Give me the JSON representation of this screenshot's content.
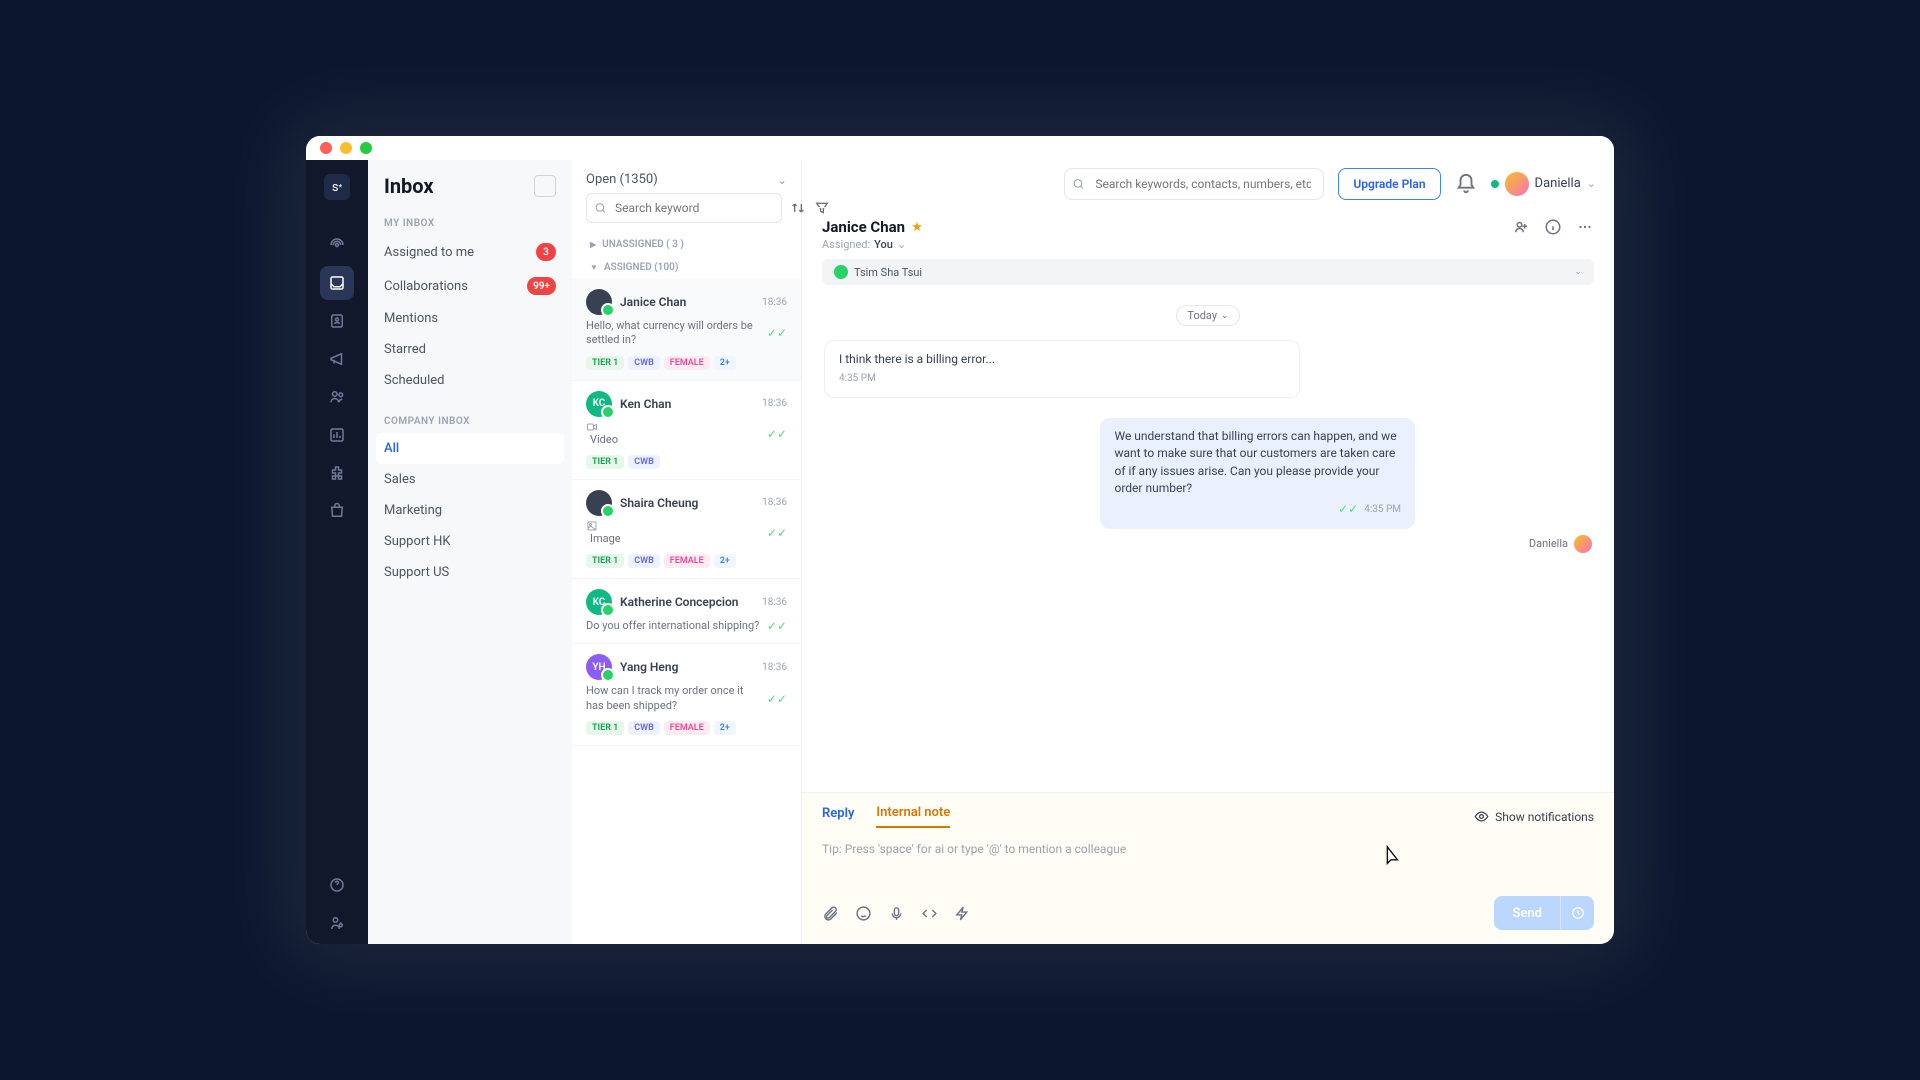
{
  "sidebar": {
    "title": "Inbox",
    "sections": {
      "myInboxLabel": "MY INBOX",
      "companyLabel": "COMPANY INBOX"
    },
    "myInbox": [
      {
        "label": "Assigned to me",
        "badge": "3"
      },
      {
        "label": "Collaborations",
        "badge": "99+"
      },
      {
        "label": "Mentions"
      },
      {
        "label": "Starred"
      },
      {
        "label": "Scheduled"
      }
    ],
    "company": [
      {
        "label": "All",
        "selected": true
      },
      {
        "label": "Sales"
      },
      {
        "label": "Marketing"
      },
      {
        "label": "Support HK"
      },
      {
        "label": "Support US"
      }
    ]
  },
  "convoList": {
    "filterLabel": "Open (1350)",
    "searchPlaceholder": "Search keyword",
    "groups": {
      "unassigned": "UNASSIGNED ( 3 )",
      "assigned": "ASSIGNED (100)"
    },
    "items": [
      {
        "name": "Janice Chan",
        "time": "18:36",
        "avatar": {
          "text": "",
          "color": "dark"
        },
        "preview": "Hello, what currency will orders be settled in?",
        "tags": [
          "TIER 1",
          "CWB",
          "FEMALE",
          "2+"
        ]
      },
      {
        "name": "Ken Chan",
        "time": "18:36",
        "avatar": {
          "text": "KC",
          "color": "grn"
        },
        "preview": "Video",
        "previewIcon": "video",
        "tags": [
          "TIER 1",
          "CWB"
        ]
      },
      {
        "name": "Shaira Cheung",
        "time": "18:36",
        "avatar": {
          "text": "",
          "color": "dark"
        },
        "preview": "Image",
        "previewIcon": "image",
        "tags": [
          "TIER 1",
          "CWB",
          "FEMALE",
          "2+"
        ]
      },
      {
        "name": "Katherine Concepcion",
        "time": "18:36",
        "avatar": {
          "text": "KC",
          "color": "grn"
        },
        "preview": "Do you offer international shipping?",
        "tags": []
      },
      {
        "name": "Yang Heng",
        "time": "18:36",
        "avatar": {
          "text": "YH",
          "color": "pur"
        },
        "preview": "How can I track my order once it has been shipped?",
        "tags": [
          "TIER 1",
          "CWB",
          "FEMALE",
          "2+"
        ]
      }
    ]
  },
  "topbar": {
    "searchPlaceholder": "Search keywords, contacts, numbers, etc.",
    "upgradeLabel": "Upgrade Plan",
    "userName": "Daniella"
  },
  "chat": {
    "contactName": "Janice Chan",
    "assignedLabel": "Assigned:",
    "assignedTo": "You",
    "location": "Tsim Sha Tsui",
    "daySeparator": "Today",
    "incoming": {
      "text": "I think there is a billing error...",
      "time": "4:35 PM"
    },
    "outgoing": {
      "text": "We understand that billing errors can happen, and we want to make sure that our customers are taken care of if any issues arise. Can you please provide your order number?",
      "time": "4:35 PM",
      "sender": "Daniella"
    }
  },
  "composer": {
    "tabs": {
      "reply": "Reply",
      "note": "Internal note"
    },
    "showNotifications": "Show notifications",
    "placeholder": "Tip: Press 'space' for ai or type '@' to mention a colleague",
    "sendLabel": "Send"
  }
}
